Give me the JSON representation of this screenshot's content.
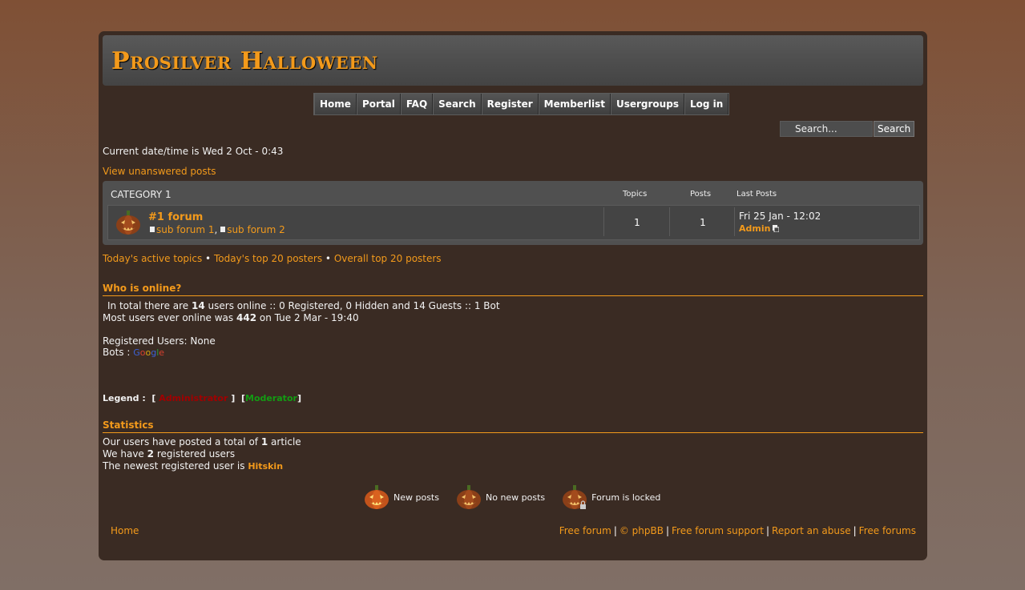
{
  "site": {
    "title": "Prosilver Halloween"
  },
  "nav": [
    "Home",
    "Portal",
    "FAQ",
    "Search",
    "Register",
    "Memberlist",
    "Usergroups",
    "Log in"
  ],
  "search": {
    "placeholder": "Search...",
    "button": "Search"
  },
  "datetime": "Current date/time is Wed 2 Oct - 0:43",
  "unanswered": "View unanswered posts",
  "category": {
    "title": "CATEGORY 1",
    "col_topics": "Topics",
    "col_posts": "Posts",
    "col_last": "Last Posts",
    "forum": {
      "name": "#1 forum",
      "subforums": [
        "sub forum 1",
        "sub forum 2"
      ],
      "subforum_separator": ",",
      "topics": "1",
      "posts": "1",
      "last_date": "Fri 25 Jan - 12:02",
      "last_author": "Admin"
    }
  },
  "quick_links": [
    "Today's active topics",
    "Today's top 20 posters",
    "Overall top 20 posters"
  ],
  "quick_sep": "•",
  "online": {
    "title": "Who is online?",
    "total_prefix": "In total there are",
    "total_num": "14",
    "total_suffix": "users online :: 0 Registered, 0 Hidden and 14 Guests :: 1 Bot",
    "most_prefix": "Most users ever online was",
    "most_num": "442",
    "most_suffix": "on Tue 2 Mar - 19:40",
    "registered": "Registered Users: None",
    "bots_label": "Bots :",
    "bot_name": [
      "G",
      "o",
      "o",
      "g",
      "l",
      "e"
    ],
    "legend_label": "Legend :",
    "legend_open": "[",
    "legend_close": "]",
    "legend_admin": "Administrator",
    "legend_mod": "Moderator"
  },
  "stats": {
    "title": "Statistics",
    "articles_prefix": "Our users have posted a total of",
    "articles_num": "1",
    "articles_suffix": "article",
    "users_prefix": "We have",
    "users_num": "2",
    "users_suffix": "registered users",
    "newest_prefix": "The newest registered user is",
    "newest_name": "Hitskin"
  },
  "icon_key": [
    "New posts",
    "No new posts",
    "Forum is locked"
  ],
  "footer": {
    "home": "Home",
    "links": [
      "Free forum",
      "© phpBB",
      "Free forum support",
      "Report an abuse",
      "Free forums"
    ],
    "separator": "|"
  },
  "colors": {
    "accent": "#f39a1b",
    "panel": "#3a2b23",
    "admin": "#a00000",
    "moderator": "#139c13"
  },
  "icons": [
    "search-icon",
    "pumpkin-icon",
    "document-icon",
    "goto-post-icon",
    "lock-icon"
  ]
}
